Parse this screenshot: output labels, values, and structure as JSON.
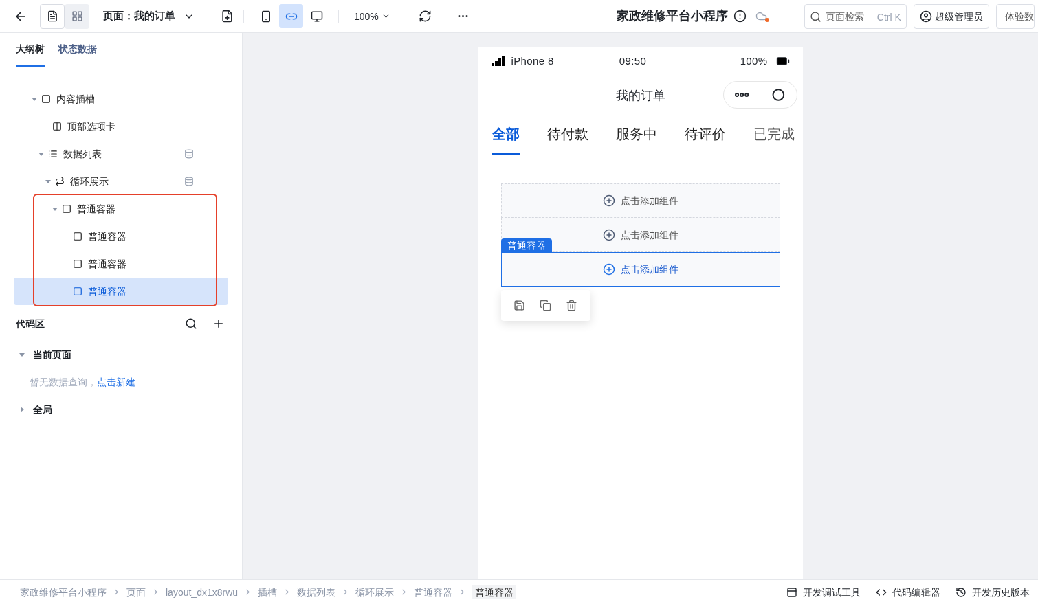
{
  "toolbar": {
    "view_modes": [
      {
        "kind": "outline",
        "selected": true
      },
      {
        "kind": "layout",
        "selected": false
      }
    ],
    "page_selector": "页面：我的订单",
    "devices": [
      {
        "kind": "phone",
        "selected": false
      },
      {
        "kind": "miniprogram",
        "selected": true
      },
      {
        "kind": "desktop",
        "selected": false
      }
    ],
    "zoom": "100%",
    "app_title": "家政维修平台小程序",
    "search": {
      "placeholder": "页面检索",
      "shortcut": "Ctrl K"
    },
    "user": "超级管理员",
    "cut_button": "体验数"
  },
  "left_panel": {
    "tabs": [
      {
        "label": "大纲树",
        "selected": true
      },
      {
        "label": "状态数据",
        "selected": false
      }
    ],
    "tree": [
      {
        "label": "内容插槽",
        "kind": "container",
        "expanded": true,
        "data_bound": false,
        "annotated": false,
        "selected": false,
        "children": [
          {
            "label": "顶部选项卡",
            "kind": "tabs",
            "data_bound": false,
            "annotated": false,
            "selected": false
          },
          {
            "label": "数据列表",
            "kind": "list",
            "expanded": true,
            "data_bound": true,
            "annotated": false,
            "selected": false,
            "children": [
              {
                "label": "循环展示",
                "kind": "loop",
                "expanded": true,
                "data_bound": true,
                "annotated": false,
                "selected": false,
                "children": [
                  {
                    "label": "普通容器",
                    "kind": "container",
                    "expanded": true,
                    "data_bound": false,
                    "annotated": true,
                    "selected": false,
                    "children": [
                      {
                        "label": "普通容器",
                        "kind": "container",
                        "data_bound": false,
                        "annotated": false,
                        "selected": false
                      },
                      {
                        "label": "普通容器",
                        "kind": "container",
                        "data_bound": false,
                        "annotated": false,
                        "selected": false
                      },
                      {
                        "label": "普通容器",
                        "kind": "container",
                        "data_bound": false,
                        "annotated": false,
                        "selected": true
                      }
                    ]
                  }
                ]
              }
            ]
          }
        ]
      }
    ],
    "code_area": {
      "title": "代码区",
      "groups": [
        {
          "label": "当前页面",
          "expanded": true,
          "empty_text": "暂无数据查询，",
          "link": "点击新建"
        },
        {
          "label": "全局",
          "expanded": false
        }
      ]
    }
  },
  "phone": {
    "carrier": "iPhone 8",
    "time": "09:50",
    "battery": "100%",
    "title": "我的订单",
    "tabs": [
      {
        "label": "全部",
        "selected": true
      },
      {
        "label": "待付款",
        "selected": false
      },
      {
        "label": "服务中",
        "selected": false
      },
      {
        "label": "待评价",
        "selected": false
      },
      {
        "label": "已完成",
        "selected": false
      }
    ],
    "slots": [
      {
        "text": "点击添加组件",
        "selected": false
      },
      {
        "text": "点击添加组件",
        "selected": false
      },
      {
        "text": "点击添加组件",
        "selected": true,
        "tag": "普通容器"
      }
    ]
  },
  "breadcrumb": [
    "家政维修平台小程序",
    "页面",
    "layout_dx1x8rwu",
    "插槽",
    "数据列表",
    "循环展示",
    "普通容器",
    "普通容器"
  ],
  "footer_tools": [
    {
      "kind": "debug",
      "label": "开发调试工具"
    },
    {
      "kind": "code",
      "label": "代码编辑器"
    },
    {
      "kind": "history",
      "label": "开发历史版本"
    }
  ]
}
